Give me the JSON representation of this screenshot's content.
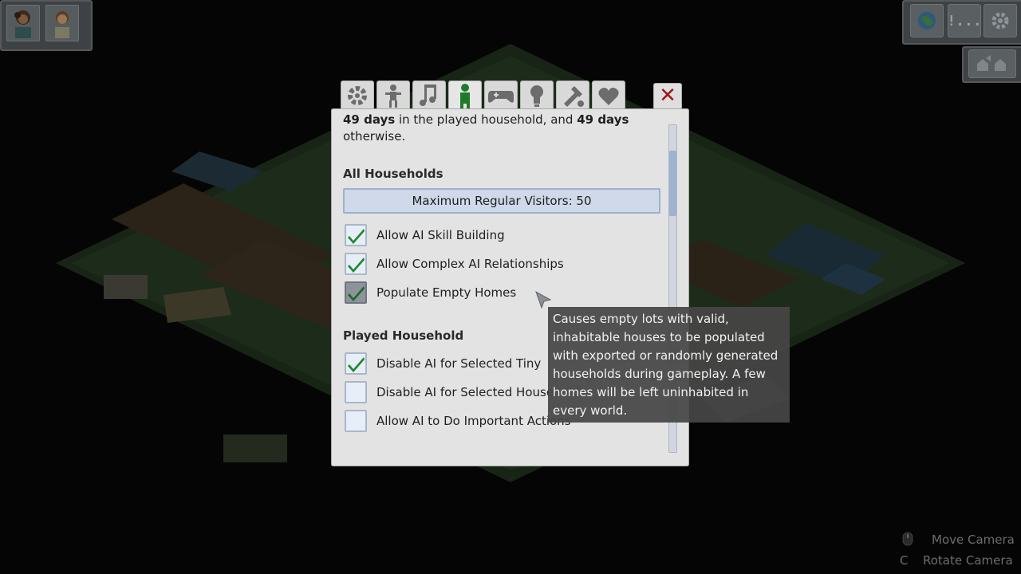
{
  "hud": {
    "portraits": [
      "sim-portrait-1",
      "sim-portrait-2"
    ],
    "top_right_buttons": [
      {
        "icon": "world-icon",
        "label": ""
      },
      {
        "icon": "notifications-icon",
        "label": "!..."
      },
      {
        "icon": "gear-icon",
        "label": ""
      }
    ],
    "export_icon": "export-household-icon"
  },
  "dialog": {
    "tabs": [
      {
        "icon": "gear-icon",
        "active": false
      },
      {
        "icon": "person-icon",
        "active": false
      },
      {
        "icon": "music-icon",
        "active": false
      },
      {
        "icon": "ai-person-icon",
        "active": true
      },
      {
        "icon": "gamepad-icon",
        "active": false
      },
      {
        "icon": "lightbulb-icon",
        "active": false
      },
      {
        "icon": "tools-icon",
        "active": false
      },
      {
        "icon": "heart-icon",
        "active": false
      }
    ],
    "close_label": "✕",
    "intro": {
      "days_1": "49 days",
      "text_1": " in the played household, and ",
      "days_2": "49 days",
      "text_2": "otherwise."
    },
    "all_households": {
      "title": "All Households",
      "visitors_button": "Maximum Regular Visitors: 50",
      "options": [
        {
          "label": "Allow AI Skill Building",
          "checked": true,
          "hovered": false
        },
        {
          "label": "Allow Complex AI Relationships",
          "checked": true,
          "hovered": false
        },
        {
          "label": "Populate Empty Homes",
          "checked": true,
          "hovered": true
        }
      ]
    },
    "played_household": {
      "title": "Played Household",
      "options": [
        {
          "label": "Disable AI for Selected Tiny",
          "checked": true
        },
        {
          "label": "Disable AI for Selected Household",
          "checked": false
        },
        {
          "label": "Allow AI to Do Important Actions",
          "checked": false
        }
      ]
    }
  },
  "tooltip": {
    "lines": [
      "Causes empty lots with valid,",
      "inhabitable houses to be populated",
      "with exported or randomly generated",
      "households during gameplay. A few",
      "homes will be left uninhabited in",
      "every world."
    ]
  },
  "hints": {
    "move_label": "Move Camera",
    "rotate_key": "C",
    "rotate_label": "Rotate Camera"
  },
  "colors": {
    "check": "#1e8a2a",
    "active_tab_icon": "#1f7a2a",
    "tab_icon": "#6c6c6c",
    "close_x": "#9c1a1a"
  }
}
